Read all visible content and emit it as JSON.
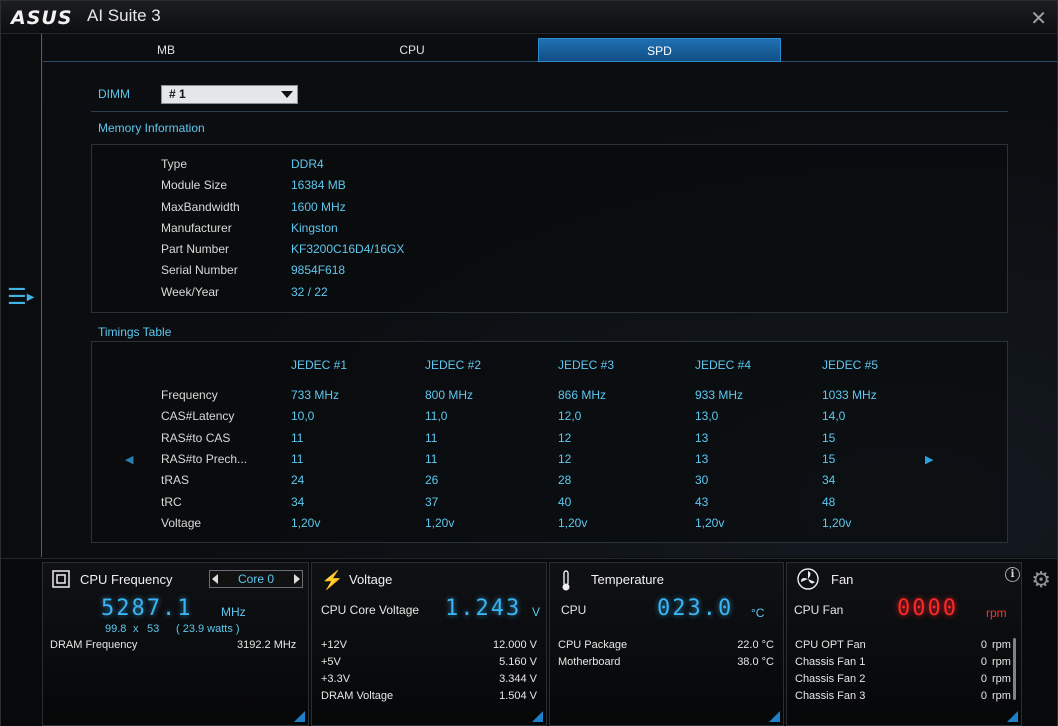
{
  "window": {
    "brand": "ASUS",
    "title": "AI Suite 3"
  },
  "tabs": [
    {
      "label": "MB"
    },
    {
      "label": "CPU"
    },
    {
      "label": "SPD",
      "active": true
    }
  ],
  "dimm": {
    "label": "DIMM",
    "selected": "# 1"
  },
  "memory_info": {
    "title": "Memory Information",
    "rows": [
      {
        "label": "Type",
        "value": "DDR4"
      },
      {
        "label": "Module Size",
        "value": "16384 MB"
      },
      {
        "label": "MaxBandwidth",
        "value": "1600 MHz"
      },
      {
        "label": "Manufacturer",
        "value": "Kingston"
      },
      {
        "label": "Part Number",
        "value": "KF3200C16D4/16GX"
      },
      {
        "label": "Serial Number",
        "value": "9854F618"
      },
      {
        "label": "Week/Year",
        "value": "32 / 22"
      }
    ]
  },
  "timings": {
    "title": "Timings Table",
    "columns": [
      "JEDEC #1",
      "JEDEC #2",
      "JEDEC #3",
      "JEDEC #4",
      "JEDEC #5"
    ],
    "rows": [
      {
        "label": "Frequency",
        "values": [
          "733 MHz",
          "800 MHz",
          "866 MHz",
          "933 MHz",
          "1033 MHz"
        ]
      },
      {
        "label": "CAS#Latency",
        "values": [
          "10,0",
          "11,0",
          "12,0",
          "13,0",
          "14,0"
        ]
      },
      {
        "label": "RAS#to CAS",
        "values": [
          "11",
          "11",
          "12",
          "13",
          "15"
        ]
      },
      {
        "label": "RAS#to Prech...",
        "values": [
          "11",
          "11",
          "12",
          "13",
          "15"
        ]
      },
      {
        "label": "tRAS",
        "values": [
          "24",
          "26",
          "28",
          "30",
          "34"
        ]
      },
      {
        "label": "tRC",
        "values": [
          "34",
          "37",
          "40",
          "43",
          "48"
        ]
      },
      {
        "label": "Voltage",
        "values": [
          "1,20v",
          "1,20v",
          "1,20v",
          "1,20v",
          "1,20v"
        ]
      }
    ]
  },
  "cpu_freq": {
    "title": "CPU Frequency",
    "core_selector": "Core 0",
    "value": "5287.1",
    "unit": "MHz",
    "detail_bclk": "99.8",
    "detail_x": "x",
    "detail_mult": "53",
    "detail_watts": "( 23.9   watts )",
    "dram_label": "DRAM Frequency",
    "dram_value": "3192.2  MHz"
  },
  "voltage": {
    "title": "Voltage",
    "main_label": "CPU Core Voltage",
    "main_value": "1.243",
    "main_unit": "V",
    "rows": [
      {
        "label": "+12V",
        "value": "12.000  V"
      },
      {
        "label": "+5V",
        "value": "5.160  V"
      },
      {
        "label": "+3.3V",
        "value": "3.344  V"
      },
      {
        "label": "DRAM Voltage",
        "value": "1.504  V"
      }
    ]
  },
  "temperature": {
    "title": "Temperature",
    "main_label": "CPU",
    "main_value": "023.0",
    "main_unit": "°C",
    "rows": [
      {
        "label": "CPU Package",
        "value": "22.0 °C"
      },
      {
        "label": "Motherboard",
        "value": "38.0 °C"
      }
    ]
  },
  "fan": {
    "title": "Fan",
    "main_label": "CPU Fan",
    "main_value": "0000",
    "main_unit": "rpm",
    "rows": [
      {
        "label": "CPU OPT Fan",
        "value": "0",
        "unit": "rpm"
      },
      {
        "label": "Chassis Fan 1",
        "value": "0",
        "unit": "rpm"
      },
      {
        "label": "Chassis Fan 2",
        "value": "0",
        "unit": "rpm"
      },
      {
        "label": "Chassis Fan 3",
        "value": "0",
        "unit": "rpm"
      }
    ]
  },
  "colors": {
    "accent": "#5ec8f0",
    "tab_active": "#1f71b4",
    "segment_blue": "#3ab4f2",
    "segment_red": "#ff2626"
  }
}
